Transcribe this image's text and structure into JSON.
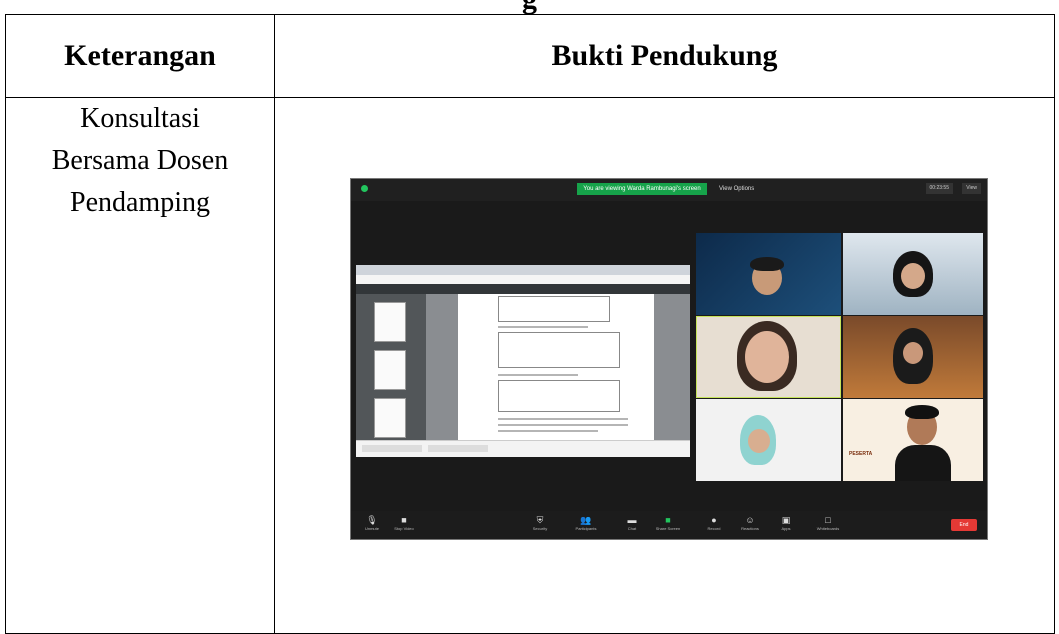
{
  "table": {
    "headers": [
      "Keterangan",
      "Bukti Pendukung"
    ],
    "rows": [
      {
        "keterangan_lines": [
          "Konsultasi",
          "Bersama Dosen",
          "Pendamping"
        ]
      }
    ]
  },
  "screenshot": {
    "top_bar": {
      "banner": "You are viewing Warda Rambunagi's screen",
      "view_options": "View Options",
      "time": "00:23:55",
      "view": "View"
    },
    "toolbar": {
      "items": [
        "Unmute",
        "Stop Video",
        "Security",
        "Participants",
        "Chat",
        "Share Screen",
        "Record",
        "Reactions",
        "Apps",
        "Whiteboards"
      ],
      "end": "End"
    },
    "participant_tile_text": "PESERTA"
  },
  "colors": {
    "zoom_bg": "#1a1a1a",
    "share_green": "#16a34a",
    "active_speaker": "#c5e35a",
    "end_red": "#e53935"
  }
}
